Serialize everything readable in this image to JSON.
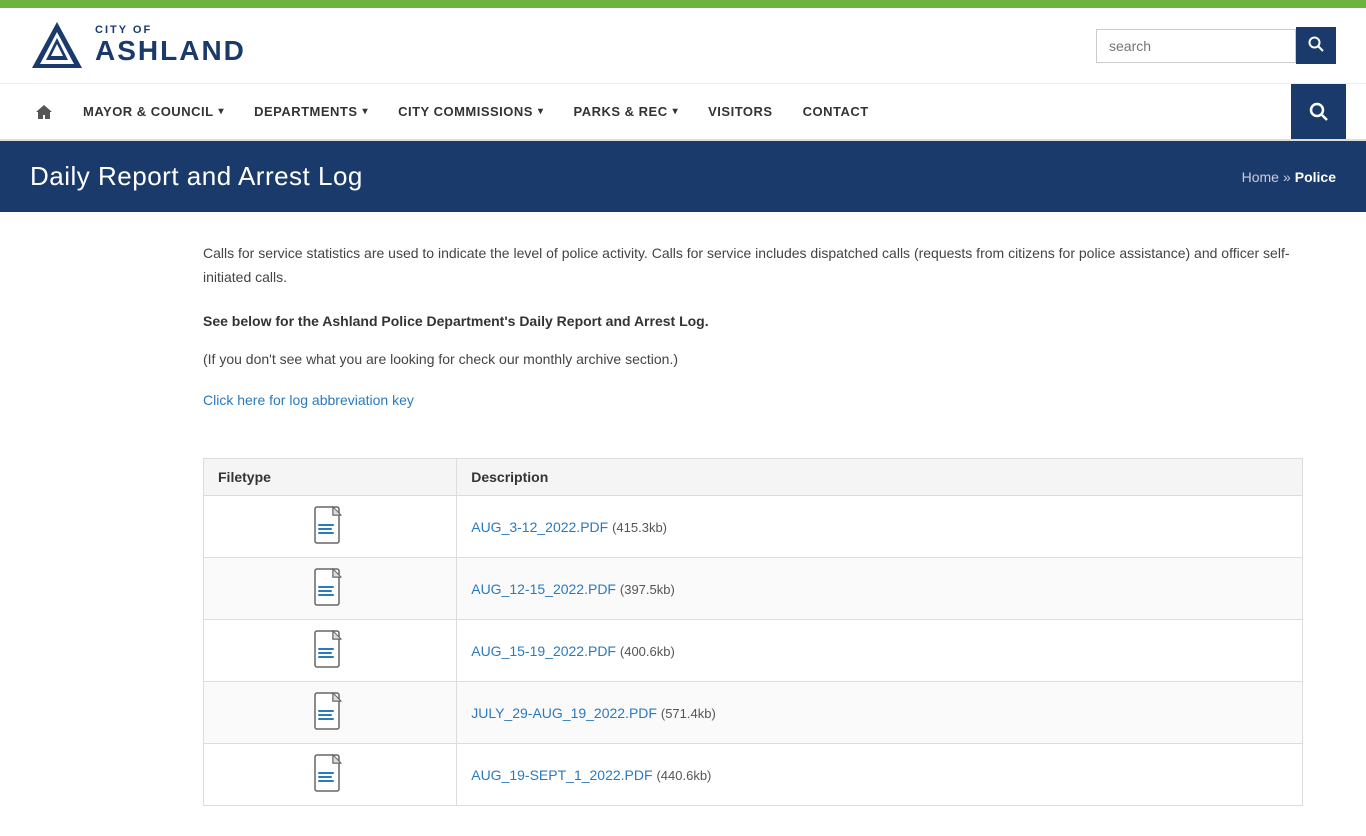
{
  "topBar": {},
  "header": {
    "logo": {
      "cityOf": "CITY OF",
      "ashland": "ASHLAND"
    },
    "search": {
      "placeholder": "search",
      "buttonLabel": "🔍"
    }
  },
  "nav": {
    "homeIcon": "⌂",
    "items": [
      {
        "label": "MAYOR & COUNCIL",
        "hasDropdown": true
      },
      {
        "label": "DEPARTMENTS",
        "hasDropdown": true
      },
      {
        "label": "CITY COMMISSIONS",
        "hasDropdown": true
      },
      {
        "label": "PARKS & REC",
        "hasDropdown": true
      },
      {
        "label": "VISITORS",
        "hasDropdown": false
      },
      {
        "label": "CONTACT",
        "hasDropdown": false
      }
    ],
    "searchIcon": "🔍"
  },
  "pageHeader": {
    "title": "Daily Report and Arrest Log",
    "breadcrumb": {
      "home": "Home",
      "separator": "»",
      "current": "Police"
    }
  },
  "content": {
    "intro1": "Calls for service statistics are used to indicate the level of police activity.  Calls for service includes dispatched calls (requests from citizens for police assistance) and officer self-initiated calls.",
    "intro2": "See below for the Ashland Police Department's Daily Report and Arrest Log.",
    "intro3": "(If you don't see what you are looking for check our monthly archive section.)",
    "abbrevLink": "Click here for log abbreviation key",
    "table": {
      "headers": [
        "Filetype",
        "Description"
      ],
      "rows": [
        {
          "filename": "AUG_3-12_2022.PDF",
          "size": "(415.3kb)"
        },
        {
          "filename": "AUG_12-15_2022.PDF",
          "size": "(397.5kb)"
        },
        {
          "filename": "AUG_15-19_2022.PDF",
          "size": "(400.6kb)"
        },
        {
          "filename": "JULY_29-AUG_19_2022.PDF",
          "size": "(571.4kb)"
        },
        {
          "filename": "AUG_19-SEPT_1_2022.PDF",
          "size": "(440.6kb)"
        }
      ]
    }
  }
}
